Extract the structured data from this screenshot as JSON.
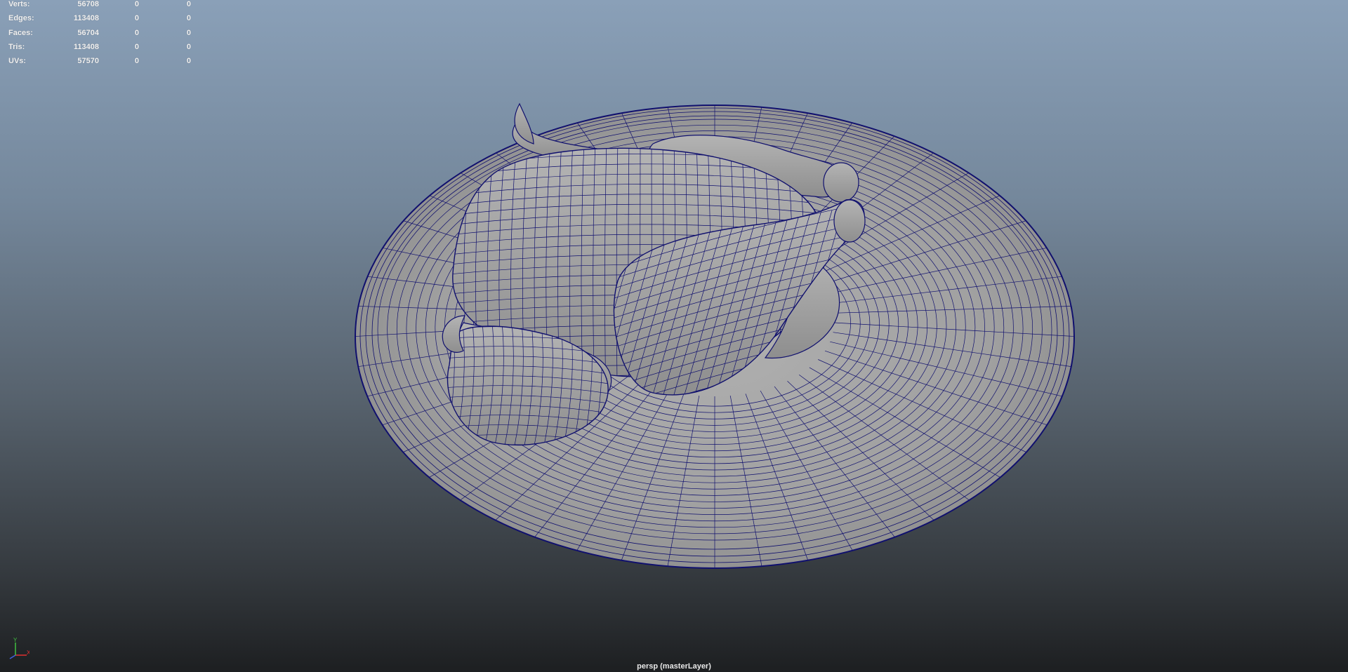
{
  "hud": {
    "rows": [
      {
        "label": "Verts:",
        "total": "56708",
        "selected": "0",
        "component": "0"
      },
      {
        "label": "Edges:",
        "total": "113408",
        "selected": "0",
        "component": "0"
      },
      {
        "label": "Faces:",
        "total": "56704",
        "selected": "0",
        "component": "0"
      },
      {
        "label": "Tris:",
        "total": "113408",
        "selected": "0",
        "component": "0"
      },
      {
        "label": "UVs:",
        "total": "57570",
        "selected": "0",
        "component": "0"
      }
    ]
  },
  "viewport": {
    "camera_label": "persp (masterLayer)",
    "wire_color": "#10106e",
    "mesh_color": "#a2a2a2"
  },
  "axis_gizmo": {
    "x_label": "X",
    "y_label": "Y",
    "x_color": "#e03030",
    "y_color": "#40c040",
    "z_color": "#4060e0",
    "icon": "axis-gizmo-icon"
  }
}
